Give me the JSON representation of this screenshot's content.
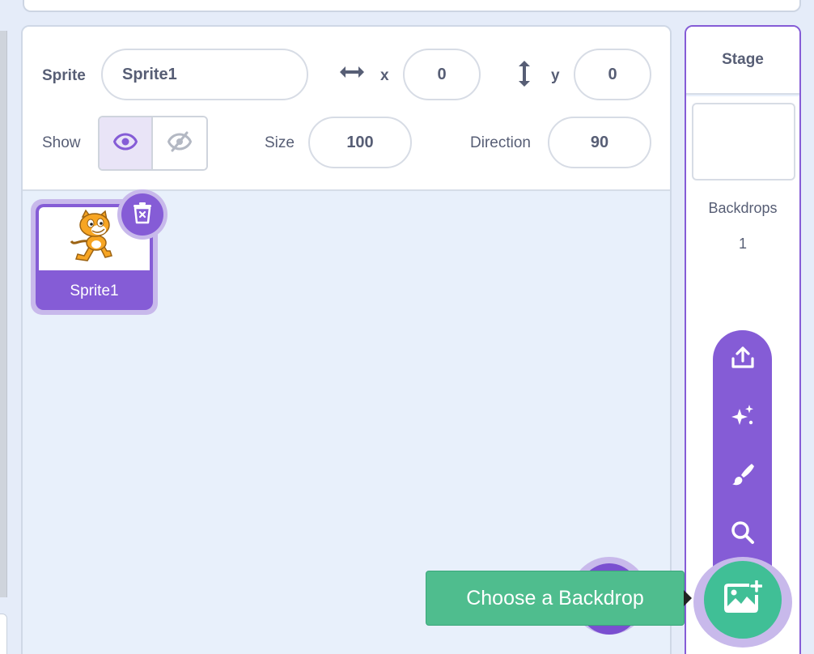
{
  "sprite_info": {
    "sprite_label": "Sprite",
    "sprite_name": "Sprite1",
    "x_label": "x",
    "x_value": "0",
    "y_label": "y",
    "y_value": "0",
    "show_label": "Show",
    "size_label": "Size",
    "size_value": "100",
    "direction_label": "Direction",
    "direction_value": "90"
  },
  "sprites": [
    {
      "name": "Sprite1",
      "selected": true
    }
  ],
  "stage": {
    "title": "Stage",
    "backdrops_label": "Backdrops",
    "backdrops_count": "1"
  },
  "backdrop_menu": {
    "items": [
      "upload-icon",
      "surprise-icon",
      "paint-icon",
      "search-icon"
    ],
    "main_icon": "add-backdrop-icon",
    "tooltip": "Choose a Backdrop"
  },
  "colors": {
    "accent": "#855cd6",
    "accent_light": "#c8b9eb",
    "green": "#40bf96",
    "text": "#575e75",
    "background": "#e5ecf9"
  }
}
